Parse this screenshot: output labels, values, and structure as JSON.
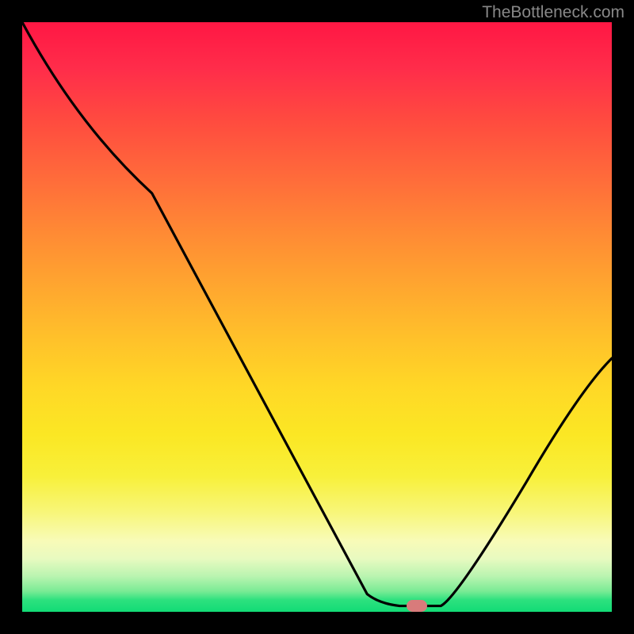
{
  "watermark": "TheBottleneck.com",
  "chart_data": {
    "type": "line",
    "title": "",
    "xlabel": "",
    "ylabel": "",
    "xlim": [
      0,
      100
    ],
    "ylim": [
      0,
      100
    ],
    "curve_points": [
      {
        "x": 0.0,
        "y": 100.0
      },
      {
        "x": 22.0,
        "y": 71.0
      },
      {
        "x": 58.5,
        "y": 3.0
      },
      {
        "x": 64.0,
        "y": 1.0
      },
      {
        "x": 71.0,
        "y": 1.0
      },
      {
        "x": 100.0,
        "y": 43.0
      }
    ],
    "marker": {
      "x": 67.0,
      "y": 1.0,
      "color": "#d87b7b"
    },
    "gradient_stops": [
      {
        "pos": 0,
        "color": "#ff1744"
      },
      {
        "pos": 50,
        "color": "#ffc22a"
      },
      {
        "pos": 85,
        "color": "#f8fbb8"
      },
      {
        "pos": 100,
        "color": "#12db76"
      }
    ]
  }
}
